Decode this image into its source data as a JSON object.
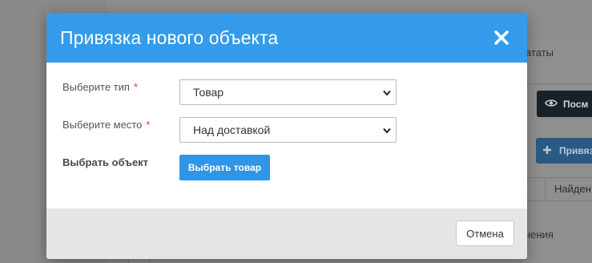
{
  "background": {
    "tab_label": "ататы",
    "view_button_label": "Посм",
    "bind_button_label": "Привяз",
    "table_header_cell": "Найден",
    "table_cell_text": "нения"
  },
  "modal": {
    "title": "Привязка нового объекта",
    "close_icon": "close-icon",
    "fields": {
      "type": {
        "label": "Выберите тип",
        "required_mark": "*",
        "value": "Товар"
      },
      "place": {
        "label": "Выберите место",
        "required_mark": "*",
        "value": "Над доставкой"
      },
      "object": {
        "label": "Выбрать объект",
        "button_label": "Выбрать товар"
      }
    },
    "footer": {
      "cancel_label": "Отмена"
    }
  },
  "colors": {
    "header_blue": "#339bea",
    "primary_button": "#2f95e6",
    "required_red": "#e3393c"
  }
}
